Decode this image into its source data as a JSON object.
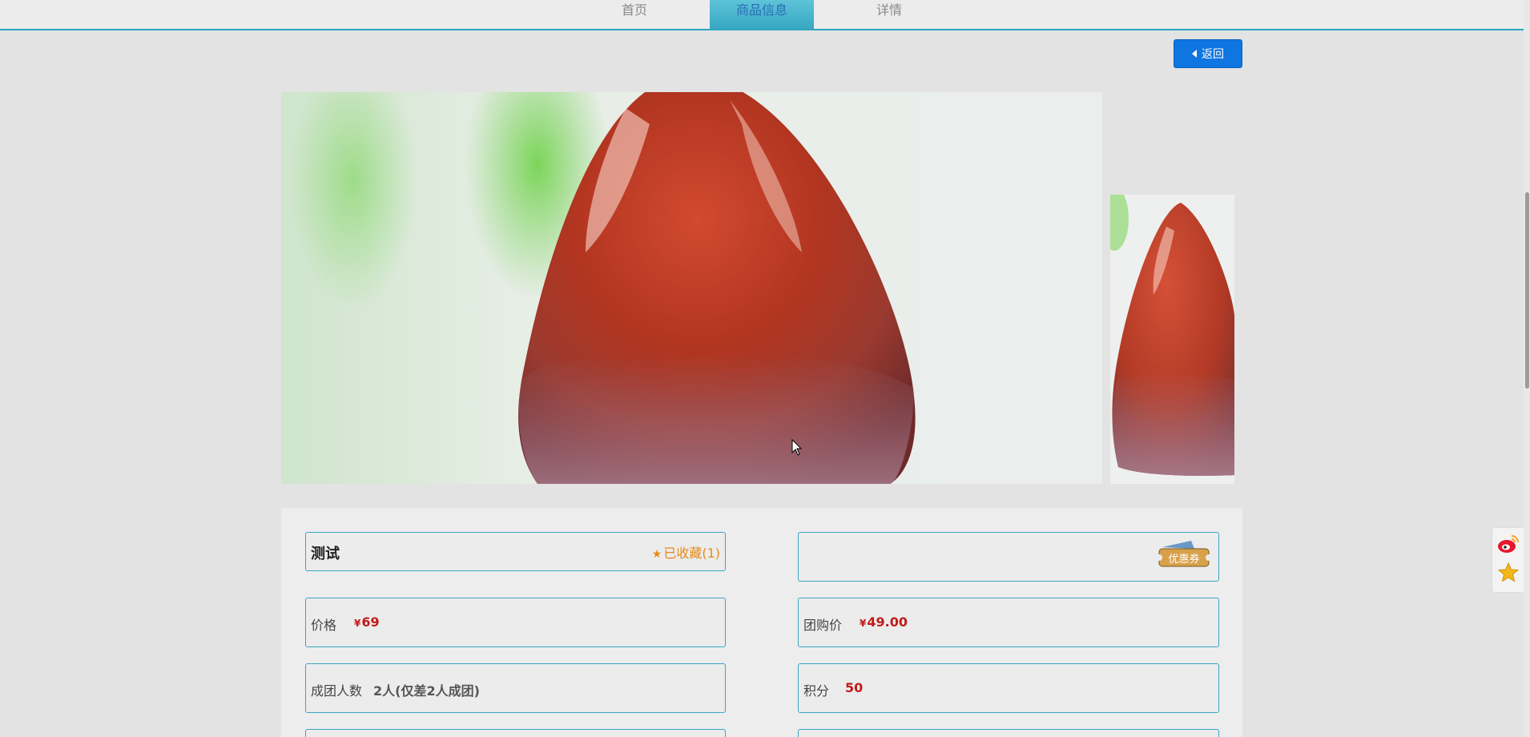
{
  "nav": {
    "items": [
      {
        "label": "首页"
      },
      {
        "label": "商品信息"
      },
      {
        "label": "详情"
      }
    ],
    "active": "商品信息"
  },
  "toolbar": {
    "back_label": "返回"
  },
  "product": {
    "title": "测试",
    "favorite_label": "已收藏(1)",
    "coupon_label": "优惠券",
    "price_label": "价格",
    "price_value": "69",
    "group_price_label": "团购价",
    "group_price_value": "49.00",
    "group_size_label": "成团人数",
    "group_size_value": "2人(仅差2人成团)",
    "points_label": "积分",
    "points_value": "50",
    "currency_symbol": "¥"
  },
  "icons": {
    "weibo": "weibo-icon",
    "favorite": "star-icon",
    "back": "caret-left-icon"
  },
  "colors": {
    "accent": "#26a6c4",
    "button": "#0f76e1",
    "price": "#c21a1a",
    "favorite": "#e68a18"
  }
}
